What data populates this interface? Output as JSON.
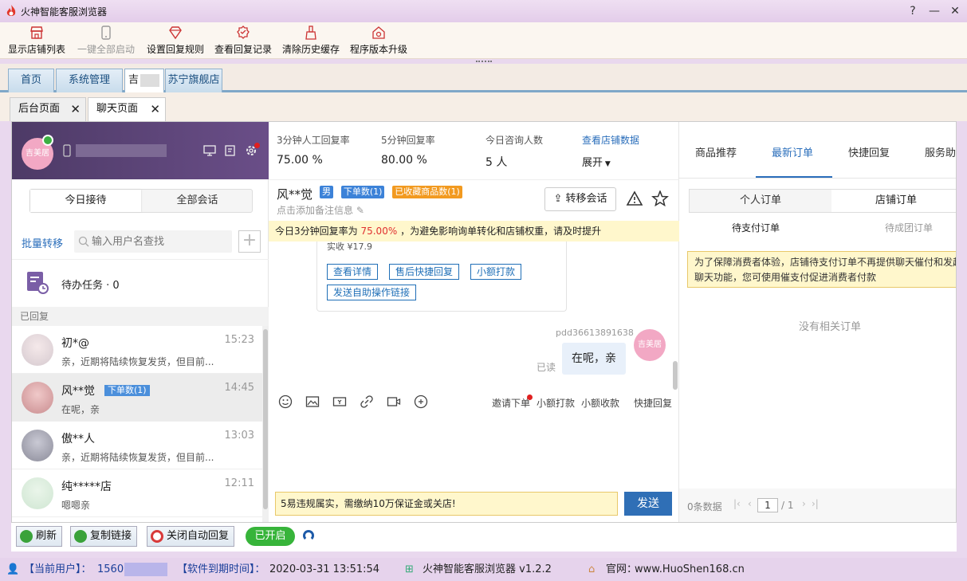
{
  "window": {
    "title": "火神智能客服浏览器"
  },
  "toolbar": {
    "items": [
      {
        "label": "显示店铺列表",
        "icon": "shop-icon"
      },
      {
        "label": "一键全部启动",
        "icon": "phone-icon",
        "disabled": true
      },
      {
        "label": "设置回复规则",
        "icon": "diamond-icon"
      },
      {
        "label": "查看回复记录",
        "icon": "badge-icon"
      },
      {
        "label": "清除历史缓存",
        "icon": "broom-icon"
      },
      {
        "label": "程序版本升级",
        "icon": "home-upgrade-icon"
      }
    ]
  },
  "main_tabs": [
    {
      "label": "首页"
    },
    {
      "label": "系统管理"
    },
    {
      "label": "吉"
    },
    {
      "label": "苏宁旗舰店"
    }
  ],
  "sub_tabs": [
    {
      "label": "后台页面",
      "close": "✕"
    },
    {
      "label": "聊天页面",
      "close": "✕"
    }
  ],
  "left": {
    "shop_avatar": "吉美居",
    "segment": {
      "today": "今日接待",
      "all": "全部会话"
    },
    "batch_transfer": "批量转移",
    "search_placeholder": "输入用户名查找",
    "plus": "+",
    "todo": {
      "label": "待办任务 · 0"
    },
    "section": "已回复",
    "conversations": [
      {
        "name": "初*@",
        "time": "15:23",
        "msg": "亲，近期将陆续恢复发货，但目前...",
        "tag": ""
      },
      {
        "name": "风**觉",
        "time": "14:45",
        "msg": "在呢，亲",
        "tag": "下单数(1)"
      },
      {
        "name": "傲**人",
        "time": "13:03",
        "msg": "亲，近期将陆续恢复发货，但目前...",
        "tag": ""
      },
      {
        "name": "纯*****店",
        "time": "12:11",
        "msg": "嗯嗯亲",
        "tag": ""
      }
    ]
  },
  "mid": {
    "stats": [
      {
        "label": "3分钟人工回复率",
        "value": "75.00 %"
      },
      {
        "label": "5分钟回复率",
        "value": "80.00 %"
      },
      {
        "label": "今日咨询人数",
        "value": "5 人"
      }
    ],
    "view_shop_data": "查看店铺数据",
    "expand": "展开",
    "customer": {
      "name": "风**觉",
      "gender": "男",
      "tag_orders": "下单数(1)",
      "tag_fav": "已收藏商品数(1)",
      "note": "点击添加备注信息"
    },
    "transfer_btn": "转移会话",
    "banner": {
      "prefix": "今日3分钟回复率为",
      "rate": "75.00%",
      "suffix": "，为避免影响询单转化和店铺权重，请及时提升"
    },
    "card_buttons": [
      "查看详情",
      "售后快捷回复",
      "小额打款",
      "发送自助操作链接"
    ],
    "card_partial_text": "实收 ¥17.9",
    "sender": "pdd36613891638",
    "read": "已读",
    "message": "在呢，亲",
    "agent_avatar": "吉美居",
    "input_tools": [
      "邀请下单",
      "小额打款",
      "小额收款",
      "快捷回复"
    ],
    "input_notice": "5易违规属实，需缴纳10万保证金或关店!",
    "send": "发送"
  },
  "right": {
    "tabs": [
      "商品推荐",
      "最新订单",
      "快捷回复",
      "服务助"
    ],
    "order_seg": {
      "personal": "个人订单",
      "shop": "店铺订单"
    },
    "sub": {
      "pending_pay": "待支付订单",
      "pending_group": "待成团订单"
    },
    "warn_line1": "为了保障消费者体验，店铺待支付订单不再提供聊天催付和发起",
    "warn_line2": "聊天功能，您可使用催支付促进消费者付款",
    "empty": "没有相关订单",
    "pager": {
      "count": "0条数据",
      "page": "1",
      "total": "/ 1"
    }
  },
  "bottom": {
    "refresh": "刷新",
    "copy_link": "复制链接",
    "close_auto": "关闭自动回复",
    "on": "已开启"
  },
  "status": {
    "user_label": "【当前用户】：",
    "user_value": "1560",
    "expire_label": "【软件到期时间】：",
    "expire_value": "2020-03-31 13:51:54",
    "app": "火神智能客服浏览器 v1.2.2",
    "site_label": "官网：",
    "site_value": "www.HuoShen168.cn"
  }
}
